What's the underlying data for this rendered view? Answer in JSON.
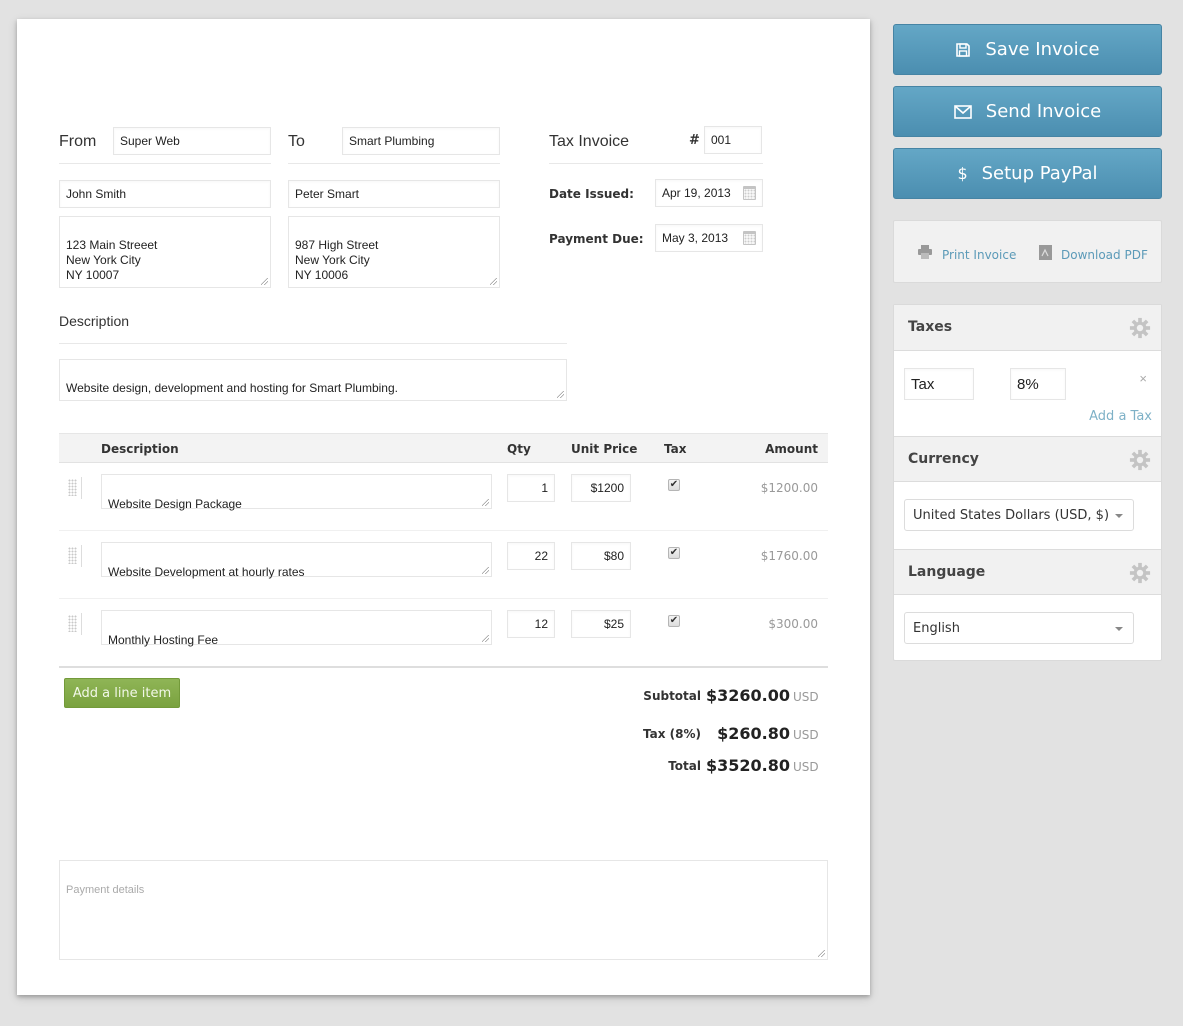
{
  "invoice": {
    "from_label": "From",
    "from_company": "Super Web",
    "from_name": "John Smith",
    "from_address": "123 Main Streeet\nNew York City\nNY 10007",
    "to_label": "To",
    "to_company": "Smart Plumbing",
    "to_name": "Peter Smart",
    "to_address": "987 High Street\nNew York City\nNY 10006",
    "title": "Tax Invoice",
    "number_label": "#",
    "number": "001",
    "date_issued_label": "Date Issued:",
    "date_issued": "Apr 19, 2013",
    "payment_due_label": "Payment Due:",
    "payment_due": "May 3, 2013",
    "description_label": "Description",
    "description": "Website design, development and hosting for Smart Plumbing."
  },
  "table": {
    "headers": [
      "Description",
      "Qty",
      "Unit Price",
      "Tax",
      "Amount"
    ],
    "rows": [
      {
        "description": "Website Design Package",
        "qty": "1",
        "unit_price": "$1200",
        "tax_checked": true,
        "tax_mark": "✔",
        "amount": "$1200.00"
      },
      {
        "description": "Website Development at hourly rates",
        "qty": "22",
        "unit_price": "$80",
        "tax_checked": true,
        "tax_mark": "✔",
        "amount": "$1760.00"
      },
      {
        "description": "Monthly Hosting Fee",
        "qty": "12",
        "unit_price": "$25",
        "tax_checked": true,
        "tax_mark": "✔",
        "amount": "$300.00"
      }
    ],
    "add_line_label": "Add a line item"
  },
  "totals": {
    "subtotal_label": "Subtotal",
    "subtotal": "$3260.00",
    "tax_label": "Tax (8%)",
    "tax": "$260.80",
    "total_label": "Total",
    "total": "$3520.80",
    "currency": "USD"
  },
  "payment_details": {
    "placeholder": "Payment details"
  },
  "sidebar": {
    "save_label": "Save Invoice",
    "send_label": "Send Invoice",
    "paypal_label": "Setup PayPal",
    "paypal_icon_glyph": "$",
    "print_label": "Print Invoice",
    "download_label": "Download PDF",
    "taxes": {
      "title": "Taxes",
      "tax_name": "Tax",
      "tax_rate": "8%",
      "remove_glyph": "×",
      "add_label": "Add a Tax"
    },
    "currency": {
      "title": "Currency",
      "selected": "United States Dollars (USD, $)"
    },
    "language": {
      "title": "Language",
      "selected": "English"
    }
  },
  "colors": {
    "button_blue": "#5a9cbd",
    "add_line_green": "#84ab4a",
    "link_blue": "#5b9ab8"
  }
}
